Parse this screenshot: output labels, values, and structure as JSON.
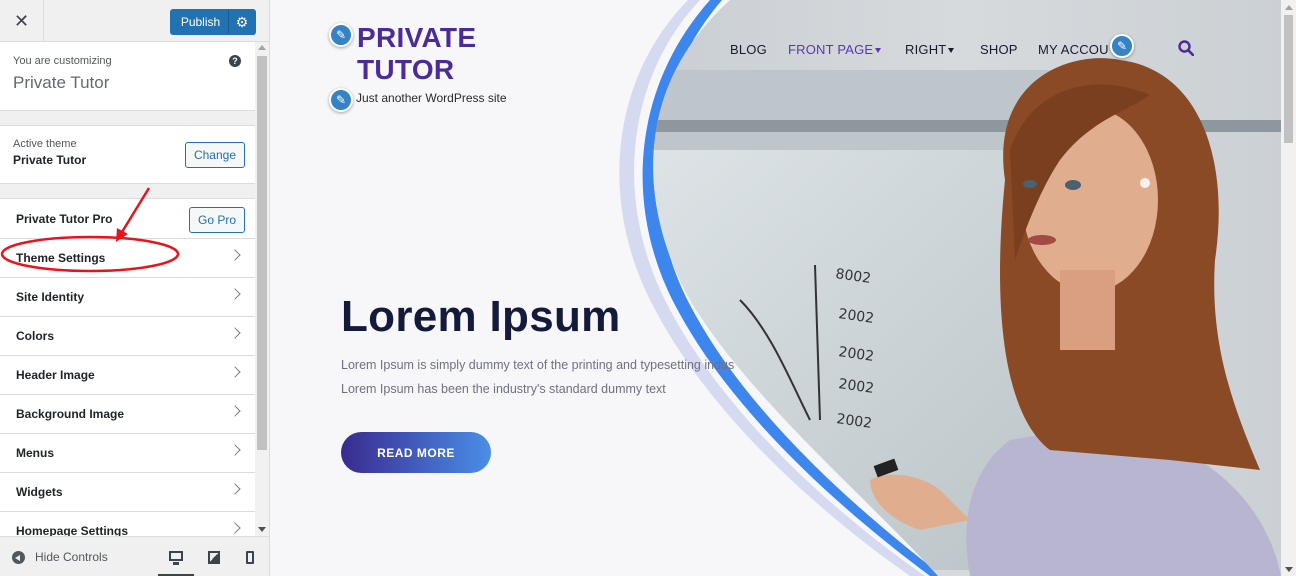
{
  "topbar": {
    "close_label": "✕",
    "publish_label": "Publish",
    "settings_icon": "gear-icon"
  },
  "info": {
    "you_are_customizing": "You are customizing",
    "site_title": "Private Tutor",
    "help_icon": "?"
  },
  "theme": {
    "label": "Active theme",
    "name": "Private Tutor",
    "change_label": "Change"
  },
  "sections": [
    {
      "label": "Private Tutor Pro",
      "button": "Go Pro"
    },
    {
      "label": "Theme Settings"
    },
    {
      "label": "Site Identity"
    },
    {
      "label": "Colors"
    },
    {
      "label": "Header Image"
    },
    {
      "label": "Background Image"
    },
    {
      "label": "Menus"
    },
    {
      "label": "Widgets"
    },
    {
      "label": "Homepage Settings"
    }
  ],
  "footer": {
    "hide_controls": "Hide Controls"
  },
  "site": {
    "title_line1": "PRIVATE",
    "title_line2": "TUTOR",
    "tagline": "Just another WordPress site",
    "nav": [
      {
        "label": "BLOG"
      },
      {
        "label": "FRONT PAGE"
      },
      {
        "label": "RIGHT"
      },
      {
        "label": "SHOP"
      },
      {
        "label": "MY ACCOU"
      }
    ],
    "hero_title": "Lorem Ipsum",
    "hero_line1": "Lorem Ipsum is simply dummy text of the printing and typesetting indus",
    "hero_line2": "Lorem Ipsum has been the industry's standard dummy text",
    "read_more": "READ MORE"
  },
  "colors": {
    "accent": "#2271b1",
    "brand_purple": "#4b2b9a",
    "hero_title": "#141a3a",
    "annotation": "#e8141b"
  }
}
